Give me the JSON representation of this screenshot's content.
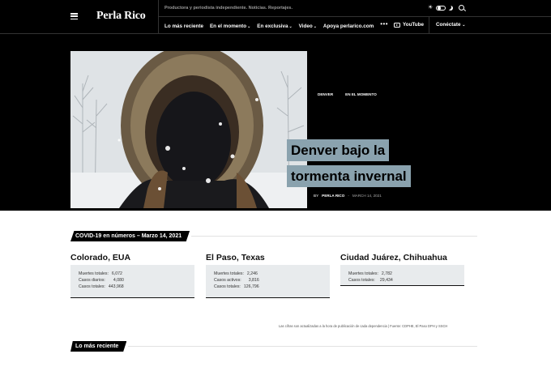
{
  "brand": {
    "name": "Perla Rico",
    "tagline": "Productora y periodista independiente. Noticias. Reportajes."
  },
  "nav": {
    "items": [
      {
        "label": "Lo más reciente",
        "dropdown": false
      },
      {
        "label": "En el momento",
        "dropdown": true
      },
      {
        "label": "En exclusiva",
        "dropdown": true
      },
      {
        "label": "Video",
        "dropdown": true
      },
      {
        "label": "Apoya perlarico.com",
        "dropdown": false
      }
    ],
    "more_label": "•••",
    "youtube_label": "YouTube",
    "connect_label": "Conéctate",
    "chevron": "⌄"
  },
  "hero": {
    "categories": [
      "DENVER",
      "EN EL MOMENTO"
    ],
    "title": "Denver bajo la tormenta invernal",
    "by": "BY",
    "author": "PERLA RICO",
    "separator": "-",
    "date": "MARCH 14, 2021"
  },
  "covid": {
    "header": "COVID-19 en números – Marzo 14, 2021",
    "cards": [
      {
        "name": "Colorado, EUA",
        "rows": [
          {
            "label": "Muertes totales:",
            "value": "6,072"
          },
          {
            "label": "Casos diarios:",
            "value": "4,080"
          },
          {
            "label": "Casos totales:",
            "value": "443,968"
          }
        ]
      },
      {
        "name": "El Paso, Texas",
        "rows": [
          {
            "label": "Muertes totales:",
            "value": "2,246"
          },
          {
            "label": "Casos activos:",
            "value": "3,816"
          },
          {
            "label": "Casos totales:",
            "value": "126,796"
          }
        ]
      },
      {
        "name": "Ciudad Juárez, Chihuahua",
        "rows": [
          {
            "label": "Muertes totales:",
            "value": "2,782"
          },
          {
            "label": "Casos totales:",
            "value": "29,434"
          }
        ]
      }
    ],
    "disclaimer": "Las cifras son actualizadas a la hora de publicación de cada dependencia | Fuente: CDPHE, El Paso DPH y SSCH"
  },
  "recent": {
    "header": "Lo más reciente"
  },
  "colors": {
    "bar": "#000000",
    "title_highlight": "#8aa2ae",
    "card_bg": "#e8ebed"
  }
}
